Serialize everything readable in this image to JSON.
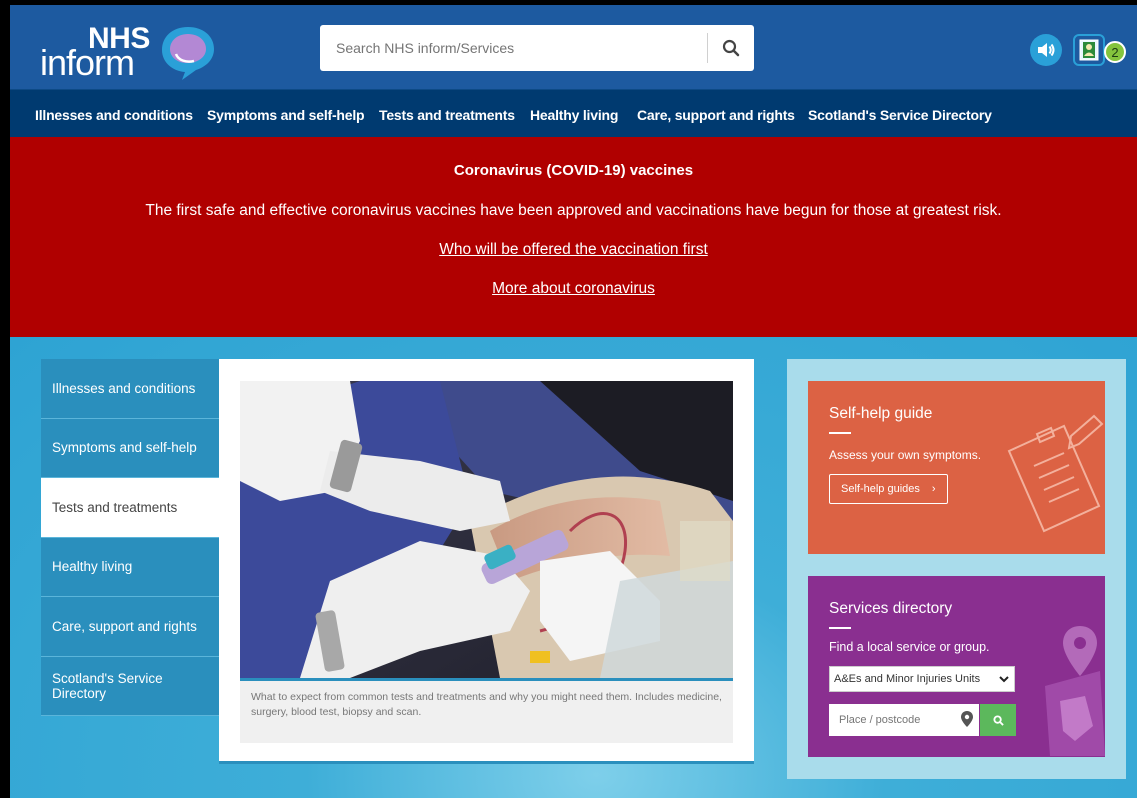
{
  "header": {
    "logo_top": "NHS",
    "logo_bottom": "inform",
    "search_placeholder": "Search NHS inform/Services",
    "badge_count": "2"
  },
  "nav": {
    "items": [
      "Illnesses and conditions",
      "Symptoms and self-help",
      "Tests and treatments",
      "Healthy living",
      "Care, support and rights",
      "Scotland's Service Directory"
    ]
  },
  "banner": {
    "title": "Coronavirus (COVID-19) vaccines",
    "text": "The first safe and effective coronavirus vaccines have been approved and vaccinations have begun for those at greatest risk.",
    "link1": "Who will be offered the vaccination first",
    "link2": "More about coronavirus"
  },
  "sidenav": {
    "items": [
      "Illnesses and conditions",
      "Symptoms and self-help",
      "Tests and treatments",
      "Healthy living",
      "Care, support and rights",
      "Scotland's Service Directory"
    ],
    "active_index": 2
  },
  "feature": {
    "caption": "What to expect from common tests and treatments and why you might need them. Includes medicine, surgery, blood test, biopsy and scan."
  },
  "selfhelp": {
    "title": "Self-help guide",
    "desc": "Assess your own symptoms.",
    "button": "Self-help guides",
    "button_chevron": "›"
  },
  "services": {
    "title": "Services directory",
    "desc": "Find a local service or group.",
    "select_value": "A&Es and Minor Injuries Units",
    "postcode_placeholder": "Place / postcode"
  },
  "colors": {
    "header": "#1d5aa0",
    "nav": "#003a70",
    "banner": "#b00000",
    "selfhelp": "#dc6244",
    "services": "#8a2f90",
    "go_button": "#5cb85c"
  }
}
